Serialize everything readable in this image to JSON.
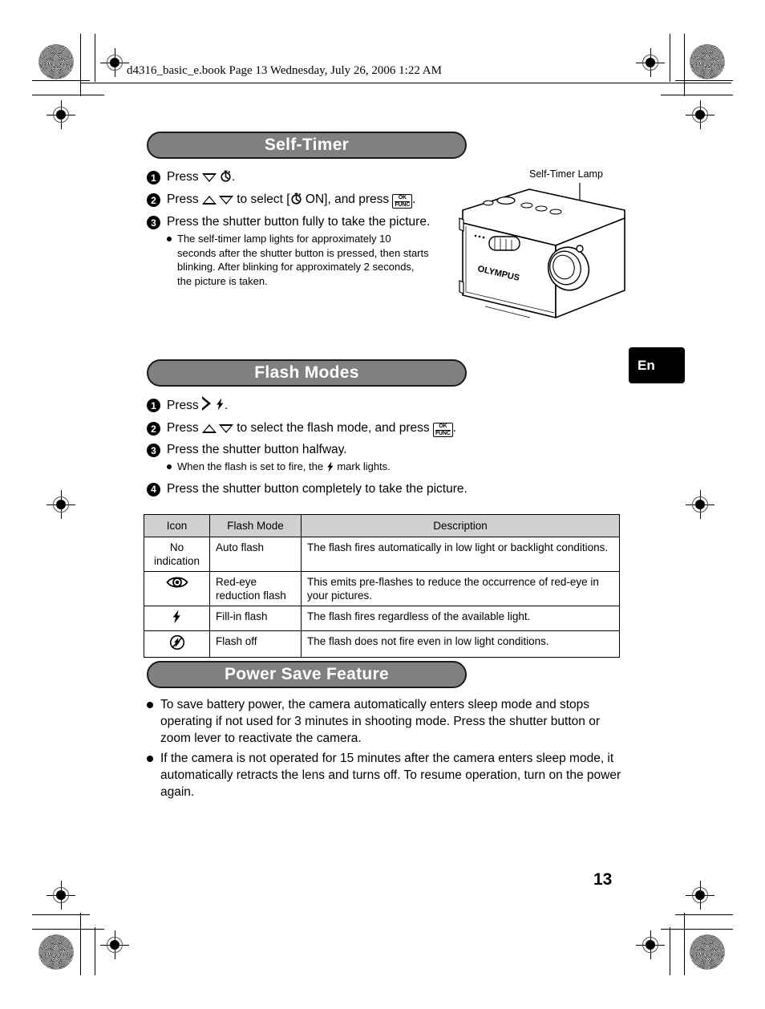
{
  "document": {
    "header_line": "d4316_basic_e.book  Page 13  Wednesday, July 26, 2006  1:22 AM",
    "page_number": "13",
    "language_tab": "En"
  },
  "sections": [
    {
      "title": "Self-Timer",
      "steps": [
        {
          "number": "1",
          "text_before": "Press ",
          "icons": [
            "triangle-down",
            "self-timer"
          ],
          "text_after": "."
        },
        {
          "number": "2",
          "text_before": "Press ",
          "icons": [
            "triangle-up",
            "triangle-down"
          ],
          "text_mid": " to select [",
          "icon_mid": "self-timer",
          "text_mid2": " ON], and press ",
          "icon_end": "ok-func",
          "text_after": "."
        },
        {
          "number": "3",
          "text_before": "Press the shutter button fully to take the picture."
        }
      ],
      "notes": [
        "The self-timer lamp lights for approximately 10 seconds after the shutter button is pressed, then starts blinking. After blinking for approximately 2 seconds, the picture is taken."
      ]
    },
    {
      "title": "Flash Modes",
      "steps": [
        {
          "number": "1",
          "text_before": "Press ",
          "icons": [
            "triangle-right",
            "flash-bolt"
          ],
          "text_after": "."
        },
        {
          "number": "2",
          "text_before": "Press ",
          "icons": [
            "triangle-up",
            "triangle-down"
          ],
          "text_mid": " to select the flash mode, and press ",
          "icon_end": "ok-func",
          "text_after": "."
        },
        {
          "number": "3",
          "text_before": "Press the shutter button halfway."
        },
        {
          "number": "4",
          "text_before": "Press the shutter button completely to take the picture."
        }
      ],
      "notes": [
        {
          "text_before": "When the flash is set to fire, the ",
          "icon": "flash-bolt",
          "text_after": " mark lights."
        }
      ]
    },
    {
      "title": "Power Save Feature",
      "bullets": [
        "To save battery power, the camera automatically enters sleep mode and stops operating if not used for 3 minutes in shooting mode. Press the shutter button or zoom lever to reactivate the camera.",
        "If the camera is not operated for 15 minutes after the camera enters sleep mode, it automatically retracts the lens and turns off. To resume operation, turn on the power again."
      ]
    }
  ],
  "flash_table": {
    "headers": [
      "Icon",
      "Flash Mode",
      "Description"
    ],
    "rows": [
      {
        "icon_type": "text",
        "icon_text": "No indication",
        "mode": "Auto flash",
        "description": "The flash fires automatically in low light or backlight conditions."
      },
      {
        "icon_type": "red-eye",
        "icon_text": "",
        "mode": "Red-eye reduction flash",
        "description": "This emits pre-flashes to reduce the occurrence of red-eye in your pictures."
      },
      {
        "icon_type": "flash-bolt",
        "icon_text": "",
        "mode": "Fill-in flash",
        "description": "The flash fires regardless of the available light."
      },
      {
        "icon_type": "flash-off",
        "icon_text": "",
        "mode": "Flash off",
        "description": "The flash does not fire even in low light conditions."
      }
    ]
  },
  "figure": {
    "callout_label": "Self-Timer Lamp",
    "brand_text": "OLYMPUS"
  },
  "colors": {
    "pill_fill": "#808080",
    "pill_border": "#1a1a1a",
    "table_header_fill": "#d0d0d0",
    "tab_fill": "#000000",
    "text": "#000000"
  }
}
